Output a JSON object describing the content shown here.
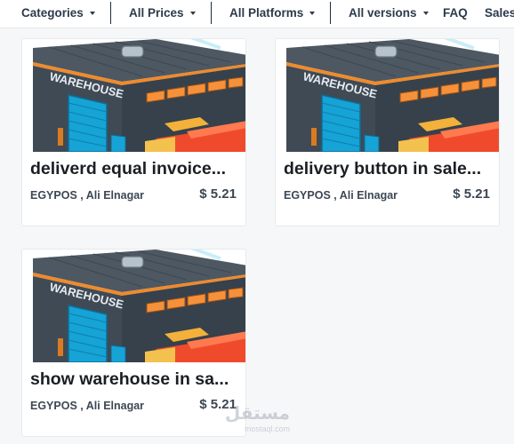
{
  "filters": {
    "categories": "Categories",
    "prices": "All Prices",
    "platforms": "All Platforms",
    "versions": "All versions",
    "faq": "FAQ",
    "sales": "Sales"
  },
  "products": [
    {
      "title": "deliverd equal invoice...",
      "seller": "EGYPOS , Ali Elnagar",
      "price": "$ 5.21",
      "image_label": "WAREHOUSE"
    },
    {
      "title": "delivery button in sale...",
      "seller": "EGYPOS , Ali Elnagar",
      "price": "$ 5.21",
      "image_label": "WAREHOUSE"
    },
    {
      "title": "show warehouse in sa...",
      "seller": "EGYPOS , Ali Elnagar",
      "price": "$ 5.21",
      "image_label": "WAREHOUSE"
    }
  ],
  "watermark": {
    "arabic": "مستقل",
    "latin": "mostaql.com"
  },
  "colors": {
    "accent": "#2d3a4a",
    "sky": "#ffffff",
    "door": "#22b8e8",
    "container_red": "#f04a2c"
  }
}
